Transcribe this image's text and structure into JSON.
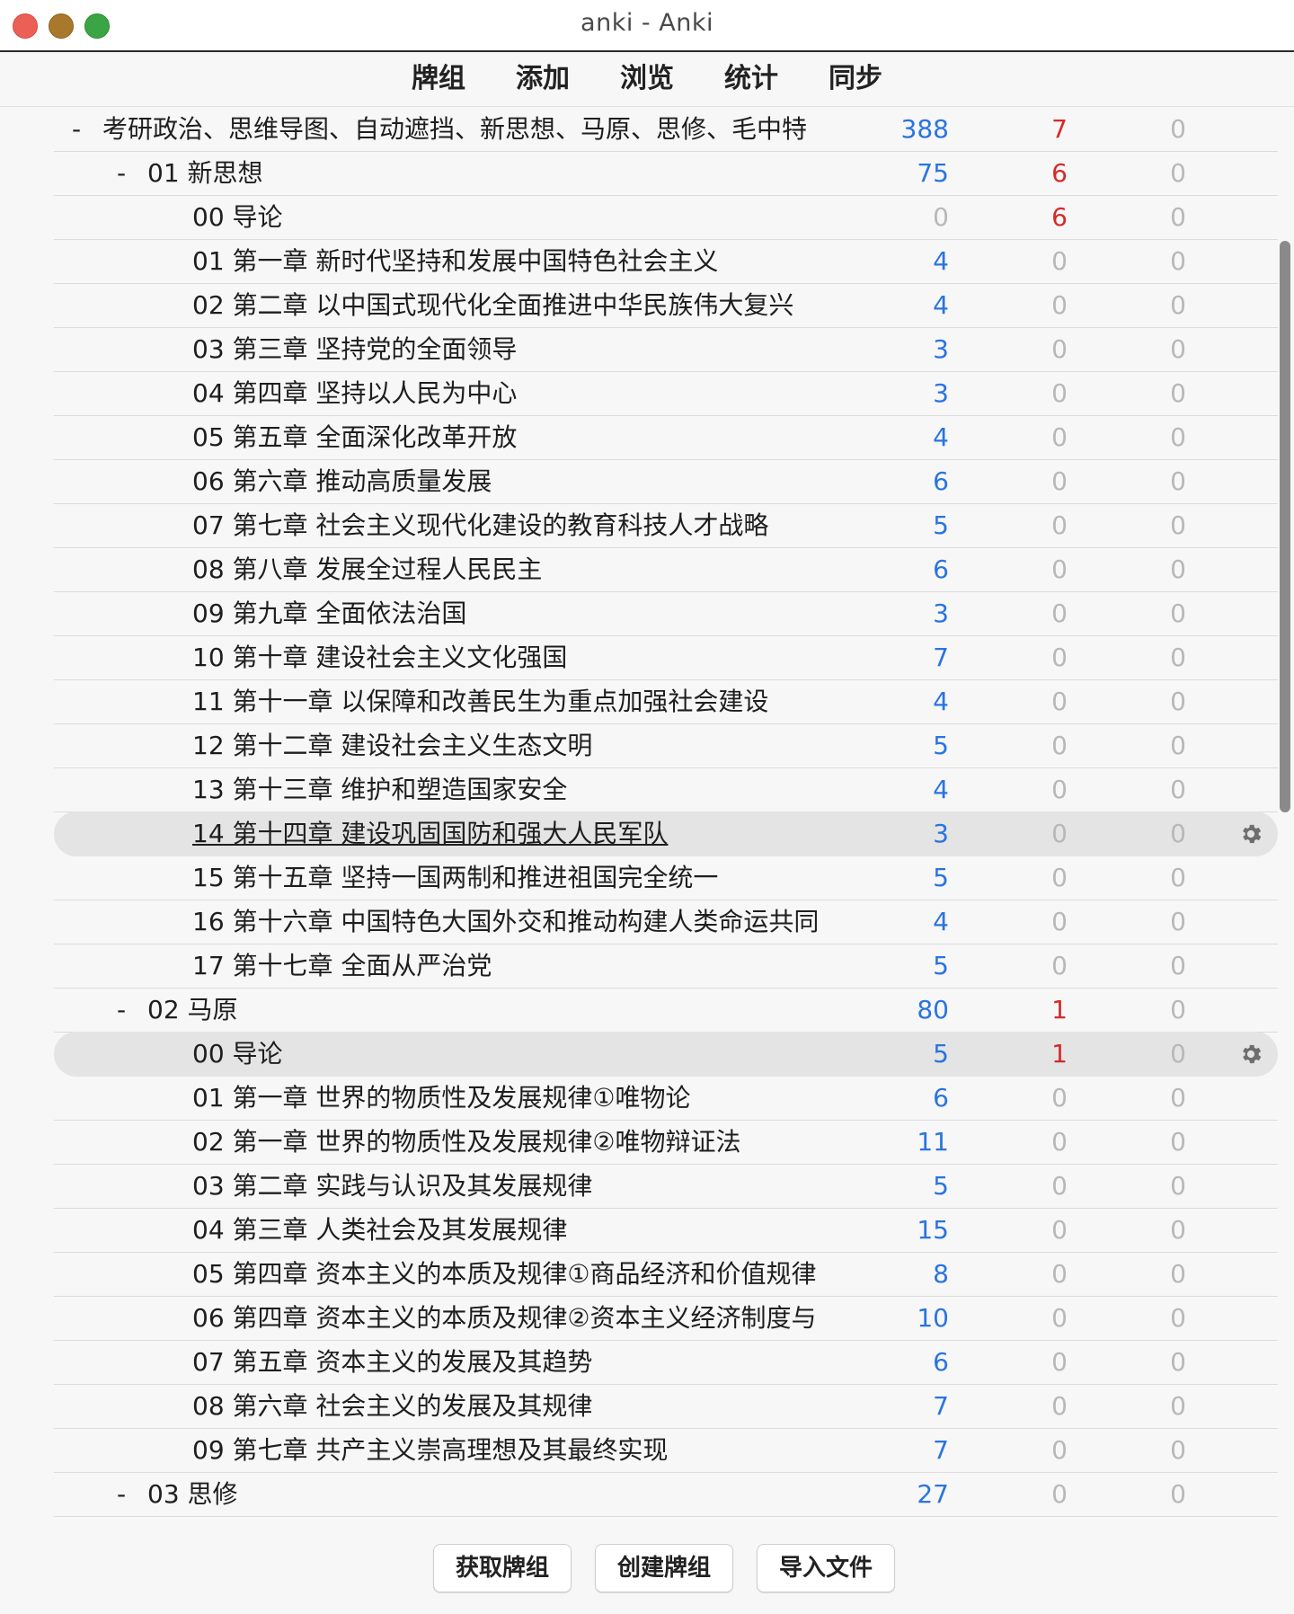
{
  "window": {
    "title": "anki - Anki"
  },
  "toolbar": {
    "items": [
      "牌组",
      "添加",
      "浏览",
      "统计",
      "同步"
    ]
  },
  "decks": [
    {
      "level": 0,
      "collapse": "-",
      "name": "考研政治、思维导图、自动遮挡、新思想、马原、思修、毛中特",
      "new": "388",
      "learn": "7",
      "due": "0",
      "learn_color": "red",
      "new_color": "blue"
    },
    {
      "level": 1,
      "collapse": "-",
      "name": "01 新思想",
      "new": "75",
      "learn": "6",
      "due": "0",
      "learn_color": "red",
      "new_color": "blue"
    },
    {
      "level": 2,
      "collapse": "",
      "name": "00 导论",
      "new": "0",
      "learn": "6",
      "due": "0",
      "learn_color": "red",
      "new_color": "gray"
    },
    {
      "level": 2,
      "collapse": "",
      "name": "01 第一章 新时代坚持和发展中国特色社会主义",
      "new": "4",
      "learn": "0",
      "due": "0",
      "learn_color": "gray",
      "new_color": "blue"
    },
    {
      "level": 2,
      "collapse": "",
      "name": "02 第二章 以中国式现代化全面推进中华民族伟大复兴",
      "new": "4",
      "learn": "0",
      "due": "0",
      "learn_color": "gray",
      "new_color": "blue"
    },
    {
      "level": 2,
      "collapse": "",
      "name": "03 第三章 坚持党的全面领导",
      "new": "3",
      "learn": "0",
      "due": "0",
      "learn_color": "gray",
      "new_color": "blue"
    },
    {
      "level": 2,
      "collapse": "",
      "name": "04 第四章 坚持以人民为中心",
      "new": "3",
      "learn": "0",
      "due": "0",
      "learn_color": "gray",
      "new_color": "blue"
    },
    {
      "level": 2,
      "collapse": "",
      "name": "05 第五章 全面深化改革开放",
      "new": "4",
      "learn": "0",
      "due": "0",
      "learn_color": "gray",
      "new_color": "blue"
    },
    {
      "level": 2,
      "collapse": "",
      "name": "06 第六章 推动高质量发展",
      "new": "6",
      "learn": "0",
      "due": "0",
      "learn_color": "gray",
      "new_color": "blue"
    },
    {
      "level": 2,
      "collapse": "",
      "name": "07 第七章 社会主义现代化建设的教育科技人才战略",
      "new": "5",
      "learn": "0",
      "due": "0",
      "learn_color": "gray",
      "new_color": "blue"
    },
    {
      "level": 2,
      "collapse": "",
      "name": "08 第八章 发展全过程人民民主",
      "new": "6",
      "learn": "0",
      "due": "0",
      "learn_color": "gray",
      "new_color": "blue"
    },
    {
      "level": 2,
      "collapse": "",
      "name": "09 第九章 全面依法治国",
      "new": "3",
      "learn": "0",
      "due": "0",
      "learn_color": "gray",
      "new_color": "blue"
    },
    {
      "level": 2,
      "collapse": "",
      "name": "10 第十章 建设社会主义文化强国",
      "new": "7",
      "learn": "0",
      "due": "0",
      "learn_color": "gray",
      "new_color": "blue"
    },
    {
      "level": 2,
      "collapse": "",
      "name": "11 第十一章 以保障和改善民生为重点加强社会建设",
      "new": "4",
      "learn": "0",
      "due": "0",
      "learn_color": "gray",
      "new_color": "blue"
    },
    {
      "level": 2,
      "collapse": "",
      "name": "12 第十二章 建设社会主义生态文明",
      "new": "5",
      "learn": "0",
      "due": "0",
      "learn_color": "gray",
      "new_color": "blue"
    },
    {
      "level": 2,
      "collapse": "",
      "name": "13 第十三章 维护和塑造国家安全",
      "new": "4",
      "learn": "0",
      "due": "0",
      "learn_color": "gray",
      "new_color": "blue"
    },
    {
      "level": 2,
      "collapse": "",
      "name": "14 第十四章 建设巩固国防和强大人民军队",
      "new": "3",
      "learn": "0",
      "due": "0",
      "learn_color": "gray",
      "new_color": "blue",
      "highlight": true,
      "underline": true,
      "gear": true
    },
    {
      "level": 2,
      "collapse": "",
      "name": "15 第十五章 坚持一国两制和推进祖国完全统一",
      "new": "5",
      "learn": "0",
      "due": "0",
      "learn_color": "gray",
      "new_color": "blue"
    },
    {
      "level": 2,
      "collapse": "",
      "name": "16 第十六章 中国特色大国外交和推动构建人类命运共同",
      "new": "4",
      "learn": "0",
      "due": "0",
      "learn_color": "gray",
      "new_color": "blue"
    },
    {
      "level": 2,
      "collapse": "",
      "name": "17 第十七章 全面从严治党",
      "new": "5",
      "learn": "0",
      "due": "0",
      "learn_color": "gray",
      "new_color": "blue"
    },
    {
      "level": 1,
      "collapse": "-",
      "name": "02 马原",
      "new": "80",
      "learn": "1",
      "due": "0",
      "learn_color": "red",
      "new_color": "blue"
    },
    {
      "level": 2,
      "collapse": "",
      "name": "00 导论",
      "new": "5",
      "learn": "1",
      "due": "0",
      "learn_color": "red",
      "new_color": "blue",
      "highlight": true,
      "gear": true
    },
    {
      "level": 2,
      "collapse": "",
      "name": "01 第一章 世界的物质性及发展规律①唯物论",
      "new": "6",
      "learn": "0",
      "due": "0",
      "learn_color": "gray",
      "new_color": "blue"
    },
    {
      "level": 2,
      "collapse": "",
      "name": "02 第一章 世界的物质性及发展规律②唯物辩证法",
      "new": "11",
      "learn": "0",
      "due": "0",
      "learn_color": "gray",
      "new_color": "blue"
    },
    {
      "level": 2,
      "collapse": "",
      "name": "03 第二章 实践与认识及其发展规律",
      "new": "5",
      "learn": "0",
      "due": "0",
      "learn_color": "gray",
      "new_color": "blue"
    },
    {
      "level": 2,
      "collapse": "",
      "name": "04 第三章 人类社会及其发展规律",
      "new": "15",
      "learn": "0",
      "due": "0",
      "learn_color": "gray",
      "new_color": "blue"
    },
    {
      "level": 2,
      "collapse": "",
      "name": "05 第四章 资本主义的本质及规律①商品经济和价值规律",
      "new": "8",
      "learn": "0",
      "due": "0",
      "learn_color": "gray",
      "new_color": "blue"
    },
    {
      "level": 2,
      "collapse": "",
      "name": "06 第四章 资本主义的本质及规律②资本主义经济制度与",
      "new": "10",
      "learn": "0",
      "due": "0",
      "learn_color": "gray",
      "new_color": "blue"
    },
    {
      "level": 2,
      "collapse": "",
      "name": "07 第五章 资本主义的发展及其趋势",
      "new": "6",
      "learn": "0",
      "due": "0",
      "learn_color": "gray",
      "new_color": "blue"
    },
    {
      "level": 2,
      "collapse": "",
      "name": "08 第六章 社会主义的发展及其规律",
      "new": "7",
      "learn": "0",
      "due": "0",
      "learn_color": "gray",
      "new_color": "blue"
    },
    {
      "level": 2,
      "collapse": "",
      "name": "09 第七章 共产主义崇高理想及其最终实现",
      "new": "7",
      "learn": "0",
      "due": "0",
      "learn_color": "gray",
      "new_color": "blue"
    },
    {
      "level": 1,
      "collapse": "-",
      "name": "03 思修",
      "new": "27",
      "learn": "0",
      "due": "0",
      "learn_color": "gray",
      "new_color": "blue"
    }
  ],
  "buttons": {
    "get_decks": "获取牌组",
    "create_deck": "创建牌组",
    "import_file": "导入文件"
  },
  "icons": {
    "gear": "gear-icon"
  },
  "colors": {
    "new": "#2a74e0",
    "learn_red": "#d42a2a",
    "zero_gray": "#b8b8b8",
    "highlight_row": "#e4e4e4"
  }
}
